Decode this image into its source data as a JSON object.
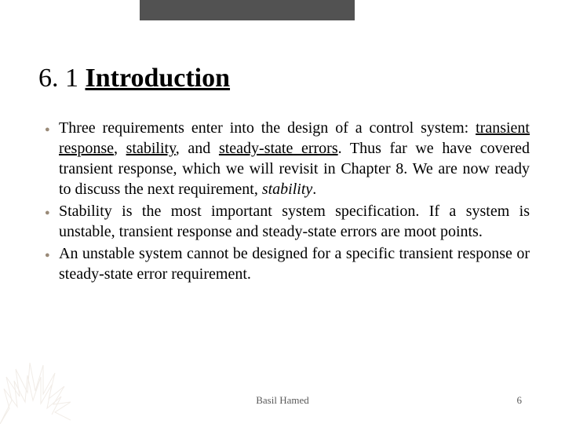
{
  "title": {
    "number": "6. 1 ",
    "heading": "Introduction"
  },
  "bullets": [
    {
      "pre": "Three requirements enter into the design of a control system: ",
      "u1": "transient response",
      "mid1": ", ",
      "u2": "stability",
      "mid2": ", and ",
      "u3": "steady-state errors",
      "mid3": ". Thus far we have covered transient response, which we will revisit in Chapter 8. We are now ready to discuss the next requirement, ",
      "it": "stability",
      "post": "."
    },
    {
      "text": "Stability is the most important system specification. If a system is unstable, transient response and steady-state errors are moot points."
    },
    {
      "text": "An unstable system cannot be designed for a specific transient response or steady-state error requirement."
    }
  ],
  "footer": {
    "author": "Basil Hamed",
    "page": "6"
  }
}
